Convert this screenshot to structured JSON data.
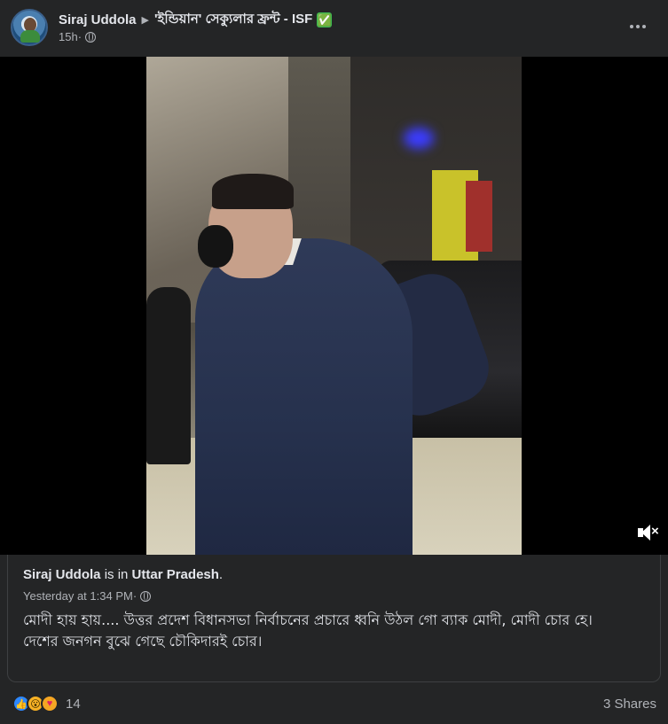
{
  "post": {
    "author": "Siraj Uddola",
    "group": "'ইন্ডিয়ান' সেক্যুলার ফ্রন্ট - ISF",
    "group_badge": "✅",
    "time": "15h",
    "time_dot": " · ",
    "icons": {
      "privacy": "globe-icon",
      "more": "more-options-icon",
      "mute": "mute-icon"
    }
  },
  "shared": {
    "author": "Siraj Uddola",
    "is_in": " is in ",
    "location": "Uttar Pradesh",
    "location_end": ".",
    "time": "Yesterday at 1:34 PM",
    "time_dot": " · ",
    "text_line1": "মোদী হায় হায়.... উত্তর প্রদেশ বিধানসভা নির্বাচনের প্রচারে ধ্বনি উঠল গো ব্যাক মোদী, মোদী চোর হে।",
    "text_line2": "দেশের জনগন বুঝে গেছে চৌকিদারই চোর।"
  },
  "footer": {
    "reaction_count": "14",
    "shares": "3 Shares",
    "reactions": [
      "like-icon",
      "wow-icon",
      "care-icon"
    ]
  },
  "colors": {
    "background": "#242526",
    "text_primary": "#e4e6eb",
    "text_secondary": "#b0b3b8",
    "like_blue": "#2d88ff"
  }
}
